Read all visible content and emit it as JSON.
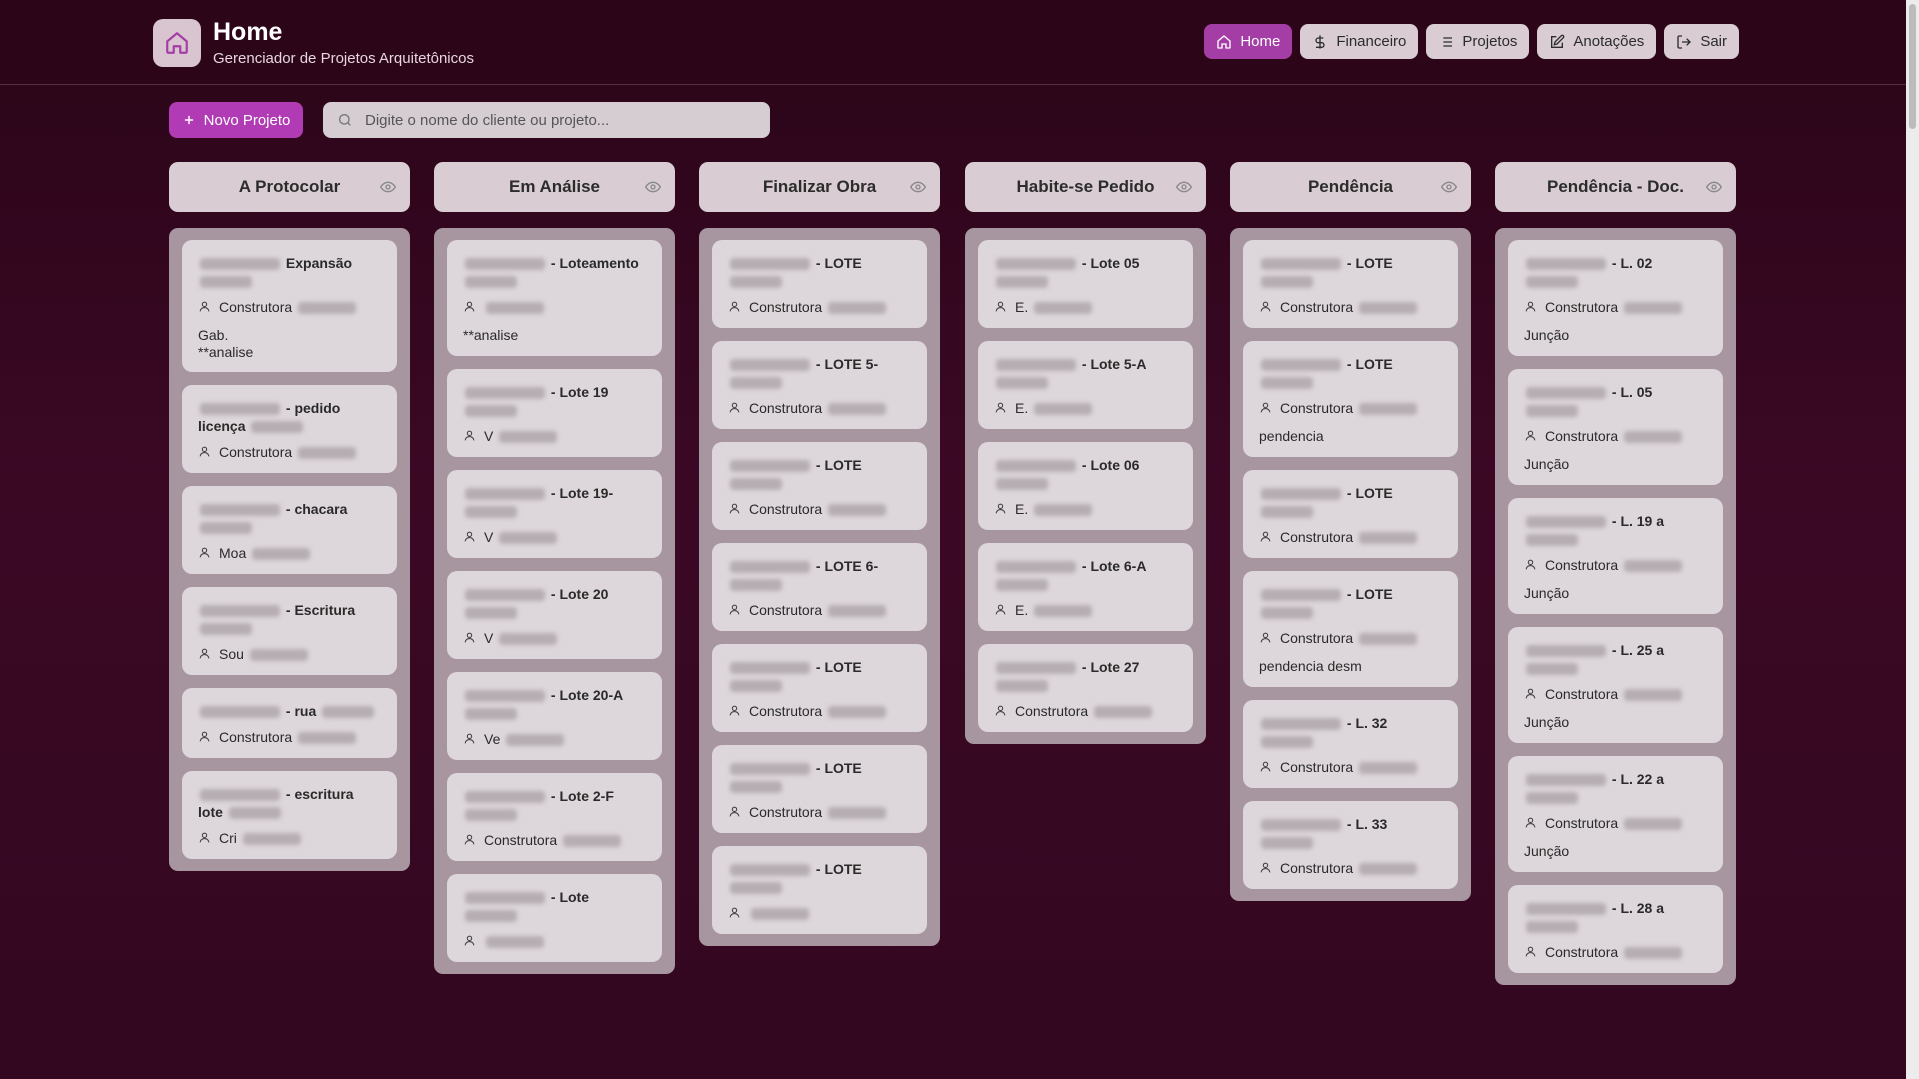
{
  "header": {
    "title": "Home",
    "subtitle": "Gerenciador de Projetos Arquitetônicos",
    "nav": [
      {
        "label": "Home",
        "icon": "home-icon",
        "active": true
      },
      {
        "label": "Financeiro",
        "icon": "dollar-icon",
        "active": false
      },
      {
        "label": "Projetos",
        "icon": "list-icon",
        "active": false
      },
      {
        "label": "Anotações",
        "icon": "edit-note-icon",
        "active": false
      },
      {
        "label": "Sair",
        "icon": "logout-icon",
        "active": false
      }
    ]
  },
  "toolbar": {
    "new_project_label": "Novo Projeto",
    "search_placeholder": "Digite o nome do cliente ou projeto..."
  },
  "colors": {
    "accent": "#a53da6",
    "primary_button": "#b03bb4",
    "background": "#330720"
  },
  "columns": [
    {
      "title": "A Protocolar",
      "cards": [
        {
          "title": "Expansão",
          "client": "Construtora",
          "note1": "Gab.",
          "note2": "**analise"
        },
        {
          "title": "- pedido licença",
          "client": "Construtora"
        },
        {
          "title": "- chacara",
          "client": "Moa"
        },
        {
          "title": "- Escritura",
          "client": "Sou"
        },
        {
          "title": "- rua",
          "client": "Construtora"
        },
        {
          "title": "- escritura lote",
          "client": "Cri"
        }
      ]
    },
    {
      "title": "Em Análise",
      "cards": [
        {
          "title": "- Loteamento",
          "client": "",
          "note1": "**analise"
        },
        {
          "title": "- Lote 19",
          "client": "V"
        },
        {
          "title": "- Lote 19-",
          "client": "V"
        },
        {
          "title": "- Lote 20",
          "client": "V"
        },
        {
          "title": "- Lote 20-A",
          "client": "Ve"
        },
        {
          "title": "- Lote 2-F",
          "client": "Construtora"
        },
        {
          "title": "- Lote",
          "client": ""
        }
      ]
    },
    {
      "title": "Finalizar Obra",
      "cards": [
        {
          "title": "- LOTE",
          "client": "Construtora"
        },
        {
          "title": "- LOTE 5-",
          "client": "Construtora"
        },
        {
          "title": "- LOTE",
          "client": "Construtora"
        },
        {
          "title": "- LOTE 6-",
          "client": "Construtora"
        },
        {
          "title": "- LOTE",
          "client": "Construtora"
        },
        {
          "title": "- LOTE",
          "client": "Construtora"
        },
        {
          "title": "- LOTE",
          "client": ""
        }
      ]
    },
    {
      "title": "Habite-se Pedido",
      "cards": [
        {
          "title": "- Lote 05",
          "client": "E."
        },
        {
          "title": "- Lote 5-A",
          "client": "E."
        },
        {
          "title": "- Lote 06",
          "client": "E."
        },
        {
          "title": "- Lote 6-A",
          "client": "E."
        },
        {
          "title": "- Lote 27",
          "client": "Construtora"
        }
      ]
    },
    {
      "title": "Pendência",
      "cards": [
        {
          "title": "- LOTE",
          "client": "Construtora"
        },
        {
          "title": "- LOTE",
          "client": "Construtora",
          "note1": "pendencia"
        },
        {
          "title": "- LOTE",
          "client": "Construtora"
        },
        {
          "title": "- LOTE",
          "client": "Construtora",
          "note1": "pendencia desm"
        },
        {
          "title": "- L. 32",
          "client": "Construtora"
        },
        {
          "title": "- L. 33",
          "client": "Construtora"
        }
      ]
    },
    {
      "title": "Pendência - Doc.",
      "cards": [
        {
          "title": "- L. 02",
          "client": "Construtora",
          "note1": "Junção"
        },
        {
          "title": "- L. 05",
          "client": "Construtora",
          "note1": "Junção"
        },
        {
          "title": "- L. 19 a",
          "client": "Construtora",
          "note1": "Junção"
        },
        {
          "title": "- L. 25 a",
          "client": "Construtora",
          "note1": "Junção"
        },
        {
          "title": "- L. 22 a",
          "client": "Construtora",
          "note1": "Junção"
        },
        {
          "title": "- L. 28 a",
          "client": "Construtora"
        }
      ]
    }
  ]
}
